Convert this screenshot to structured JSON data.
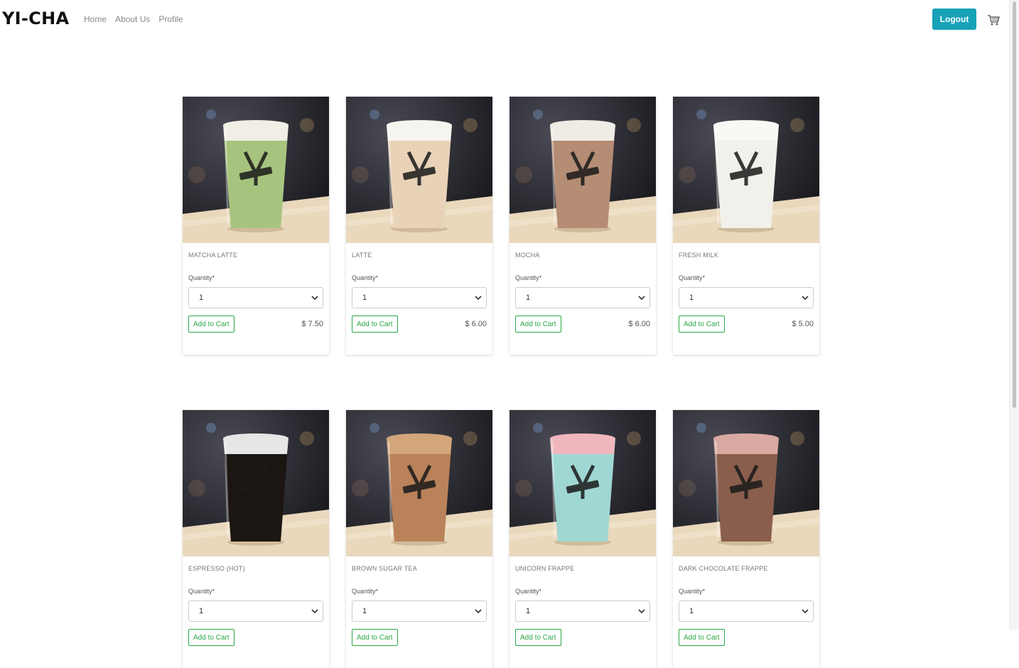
{
  "brand": "YI-CHA",
  "nav": {
    "links": [
      "Home",
      "About Us",
      "Profile"
    ],
    "logout_label": "Logout",
    "cart_icon": "shopping-cart-icon"
  },
  "colors": {
    "logout_bg": "#17a2b8",
    "add_to_cart_border": "#28a745"
  },
  "form": {
    "quantity_label": "Quantity*",
    "add_to_cart_label": "Add to Cart"
  },
  "products": [
    {
      "name": "MATCHA LATTE",
      "quantity": "1",
      "price": "$ 7.50",
      "drink_color": "#a7c47e",
      "top_color": "#f1eee6"
    },
    {
      "name": "LATTE",
      "quantity": "1",
      "price": "$ 6.00",
      "drink_color": "#e9d3b8",
      "top_color": "#f6f4ef"
    },
    {
      "name": "MOCHA",
      "quantity": "1",
      "price": "$ 6.00",
      "drink_color": "#b58c74",
      "top_color": "#efece6"
    },
    {
      "name": "FRESH MILK",
      "quantity": "1",
      "price": "$ 5.00",
      "drink_color": "#f1f0ea",
      "top_color": "#f8f8f4"
    },
    {
      "name": "ESPRESSO (HOT)",
      "quantity": "1",
      "price": "",
      "drink_color": "#1c1612",
      "top_color": "#e6e6e6"
    },
    {
      "name": "BROWN SUGAR TEA",
      "quantity": "1",
      "price": "",
      "drink_color": "#b9825a",
      "top_color": "#d3a57a"
    },
    {
      "name": "UNICORN FRAPPE",
      "quantity": "1",
      "price": "",
      "drink_color": "#9fd7d3",
      "top_color": "#efb7bd"
    },
    {
      "name": "DARK CHOCOLATE FRAPPE",
      "quantity": "1",
      "price": "",
      "drink_color": "#8a5e4c",
      "top_color": "#d9aaa2"
    }
  ]
}
